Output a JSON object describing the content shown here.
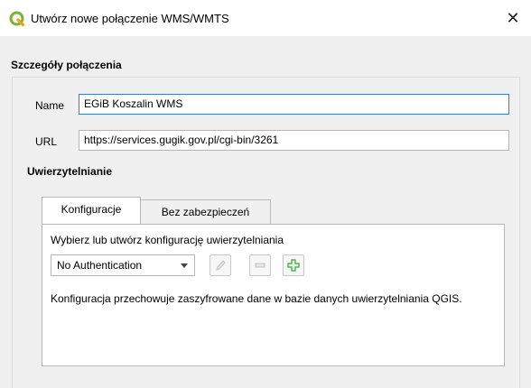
{
  "window": {
    "title": "Utwórz nowe połączenie WMS/WMTS",
    "app_icon": "qgis-icon",
    "close_label": "✕"
  },
  "details": {
    "section_title": "Szczegóły połączenia",
    "name_label": "Name",
    "name_value": "EGiB Koszalin WMS",
    "url_label": "URL",
    "url_value": "https://services.gugik.gov.pl/cgi-bin/3261"
  },
  "auth": {
    "section_title": "Uwierzytelnianie",
    "tabs": [
      {
        "label": "Konfiguracje",
        "active": true
      },
      {
        "label": "Bez zabezpieczeń",
        "active": false
      }
    ],
    "config_prompt": "Wybierz lub utwórz konfigurację uwierzytelniania",
    "selected_config": "No Authentication",
    "buttons": {
      "edit_icon": "pencil-icon",
      "remove_icon": "minus-icon",
      "add_icon": "plus-icon"
    },
    "description": "Konfiguracja przechowuje zaszyfrowane dane w bazie danych uwierzytelniania QGIS."
  },
  "colors": {
    "dialog_bg": "#f0f0f0",
    "focus_border": "#3a7bd5",
    "add_green": "#3aa53a"
  }
}
